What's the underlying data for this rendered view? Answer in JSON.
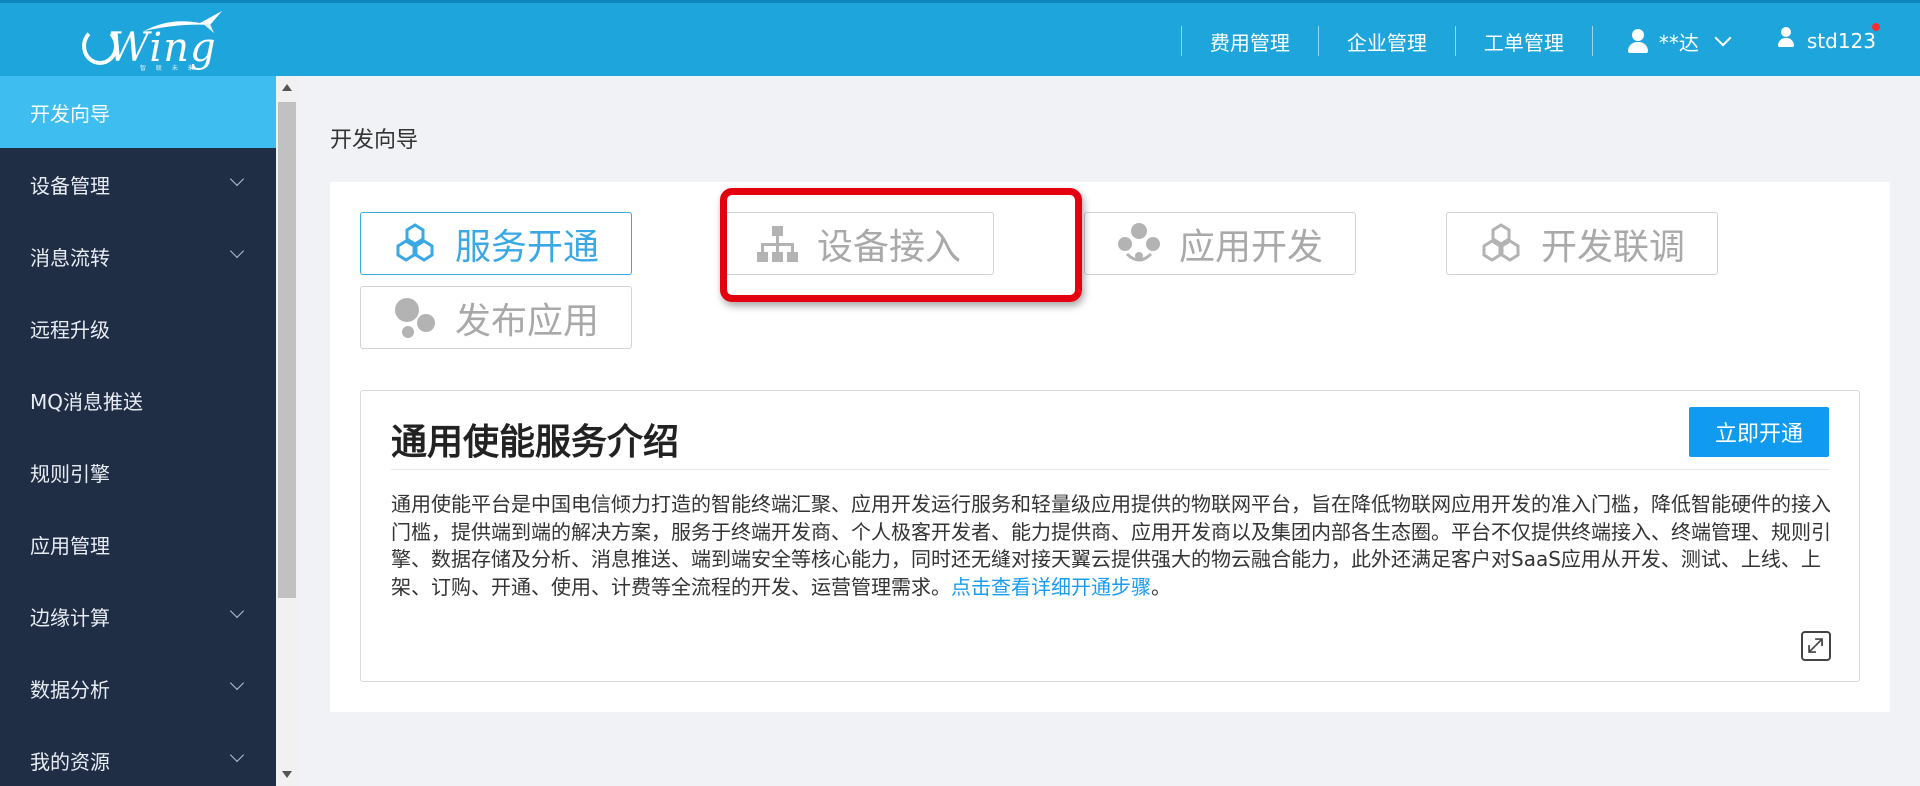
{
  "header": {
    "logo_text": "Wing",
    "logo_tagline": "智 联 未 来",
    "nav": [
      "费用管理",
      "企业管理",
      "工单管理"
    ],
    "user_name": "**达",
    "account_name": "std123"
  },
  "sidebar": {
    "items": [
      {
        "label": "开发向导",
        "active": true,
        "expandable": false
      },
      {
        "label": "设备管理",
        "active": false,
        "expandable": true
      },
      {
        "label": "消息流转",
        "active": false,
        "expandable": true
      },
      {
        "label": "远程升级",
        "active": false,
        "expandable": false
      },
      {
        "label": "MQ消息推送",
        "active": false,
        "expandable": false
      },
      {
        "label": "规则引擎",
        "active": false,
        "expandable": false
      },
      {
        "label": "应用管理",
        "active": false,
        "expandable": false
      },
      {
        "label": "边缘计算",
        "active": false,
        "expandable": true
      },
      {
        "label": "数据分析",
        "active": false,
        "expandable": true
      },
      {
        "label": "我的资源",
        "active": false,
        "expandable": true
      }
    ]
  },
  "main": {
    "page_title": "开发向导",
    "steps": [
      {
        "label": "服务开通",
        "icon": "hexagon-cluster-icon",
        "active": true
      },
      {
        "label": "设备接入",
        "icon": "org-tree-icon",
        "active": false
      },
      {
        "label": "应用开发",
        "icon": "circles-ring-icon",
        "active": false
      },
      {
        "label": "开发联调",
        "icon": "hexagon-cluster-icon",
        "active": false
      },
      {
        "label": "发布应用",
        "icon": "bubbles-icon",
        "active": false
      }
    ],
    "intro": {
      "title": "通用使能服务介绍",
      "open_button": "立即开通",
      "body": "通用使能平台是中国电信倾力打造的智能终端汇聚、应用开发运行服务和轻量级应用提供的物联网平台，旨在降低物联网应用开发的准入门槛，降低智能硬件的接入门槛，提供端到端的解决方案，服务于终端开发商、个人极客开发者、能力提供商、应用开发商以及集团内部各生态圈。平台不仅提供终端接入、终端管理、规则引擎、数据存储及分析、消息推送、端到端安全等核心能力，同时还无缝对接天翼云提供强大的物云融合能力，此外还满足客户对SaaS应用从开发、测试、上线、上架、订购、开通、使用、计费等全流程的开发、运营管理需求。",
      "link_text": "点击查看详细开通步骤",
      "trailing": "。"
    }
  },
  "colors": {
    "header_bg": "#1ea6dc",
    "sidebar_bg": "#1f2d45",
    "sidebar_active": "#3dbdf0",
    "accent": "#119bf0",
    "highlight": "#e3000f"
  }
}
